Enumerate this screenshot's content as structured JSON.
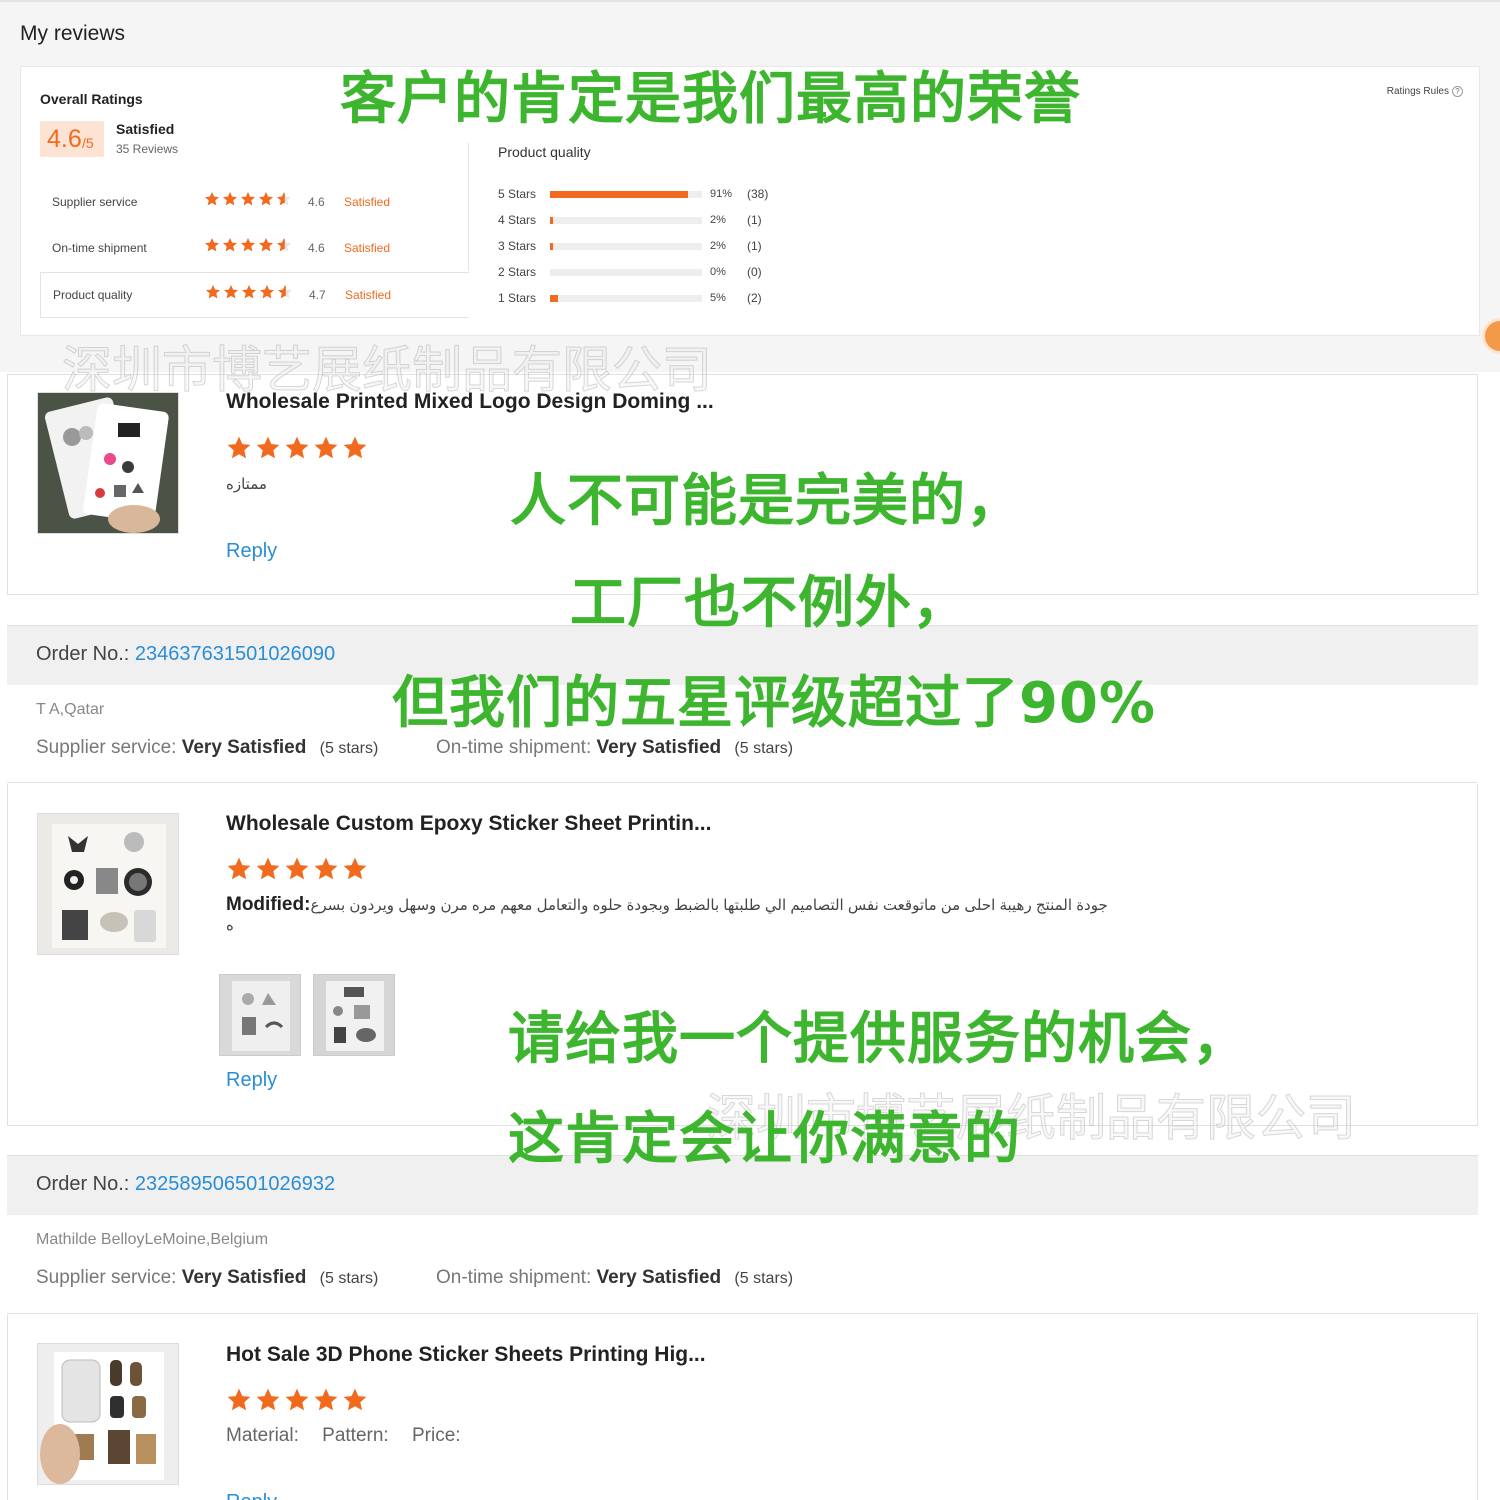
{
  "page_title": "My reviews",
  "overall": {
    "label": "Overall Ratings",
    "score": "4.6",
    "score_max": "/5",
    "status": "Satisfied",
    "reviews_count": "35 Reviews",
    "metrics": [
      {
        "label": "Supplier service",
        "score": "4.6",
        "status": "Satisfied",
        "stars": 4.6
      },
      {
        "label": "On-time shipment",
        "score": "4.6",
        "status": "Satisfied",
        "stars": 4.6
      },
      {
        "label": "Product quality",
        "score": "4.7",
        "status": "Satisfied",
        "stars": 4.7
      }
    ],
    "distribution": {
      "title": "Product quality",
      "rows": [
        {
          "label": "5  Stars",
          "pct": "91%",
          "count": "(38)",
          "fraction": 0.91
        },
        {
          "label": "4  Stars",
          "pct": "2%",
          "count": "(1)",
          "fraction": 0.02
        },
        {
          "label": "3  Stars",
          "pct": "2%",
          "count": "(1)",
          "fraction": 0.02
        },
        {
          "label": "2  Stars",
          "pct": "0%",
          "count": "(0)",
          "fraction": 0
        },
        {
          "label": "1  Stars",
          "pct": "5%",
          "count": "(2)",
          "fraction": 0.05
        }
      ]
    },
    "ratings_rules": "Ratings Rules"
  },
  "reviews": [
    {
      "product_title": "Wholesale Printed Mixed Logo Design Doming ...",
      "stars": 5,
      "text": "ممتازه",
      "reply": "Reply"
    },
    {
      "order_label": "Order No.:",
      "order_no": "234637631501026090",
      "buyer": "T A,Qatar",
      "supplier_label": "Supplier service:",
      "supplier_value": "Very Satisfied",
      "supplier_count": "(5 stars)",
      "shipment_label": "On-time shipment:",
      "shipment_value": "Very Satisfied",
      "shipment_count": "(5 stars)",
      "product_title": "Wholesale Custom Epoxy Sticker Sheet Printin...",
      "stars": 5,
      "modified_label": "Modified:",
      "text_line1": "جودة المنتج رهيبة احلى من ماتوقعت نفس التصاميم الي طلبتها بالضبط وبجودة حلوه والتعامل معهم مره مرن وسهل ويردون بسرع",
      "text_line2": "ه",
      "reply": "Reply"
    },
    {
      "order_label": "Order No.:",
      "order_no": "232589506501026932",
      "buyer": "Mathilde BelloyLeMoine,Belgium",
      "supplier_label": "Supplier service:",
      "supplier_value": "Very Satisfied",
      "supplier_count": "(5 stars)",
      "shipment_label": "On-time shipment:",
      "shipment_value": "Very Satisfied",
      "shipment_count": "(5 stars)",
      "product_title": "Hot Sale 3D Phone Sticker Sheets Printing Hig...",
      "stars": 5,
      "attr_material": "Material:",
      "attr_pattern": "Pattern:",
      "attr_price": "Price:",
      "reply": "Reply"
    }
  ],
  "overlays": {
    "line1": "客户的肯定是我们最高的荣誉",
    "line2": "人不可能是完美的，",
    "line3": "工厂也不例外，",
    "line4": "但我们的五星评级超过了90%",
    "line5": "请给我一个提供服务的机会，",
    "line6": "这肯定会让你满意的"
  },
  "watermarks": {
    "top": "深圳市博艺展纸制品有限公司",
    "bottom": "深圳市博艺展纸制品有限公司"
  },
  "colors": {
    "accent_orange": "#f16a1e",
    "link_blue": "#2a8dd8",
    "overlay_green": "#3db52e"
  }
}
